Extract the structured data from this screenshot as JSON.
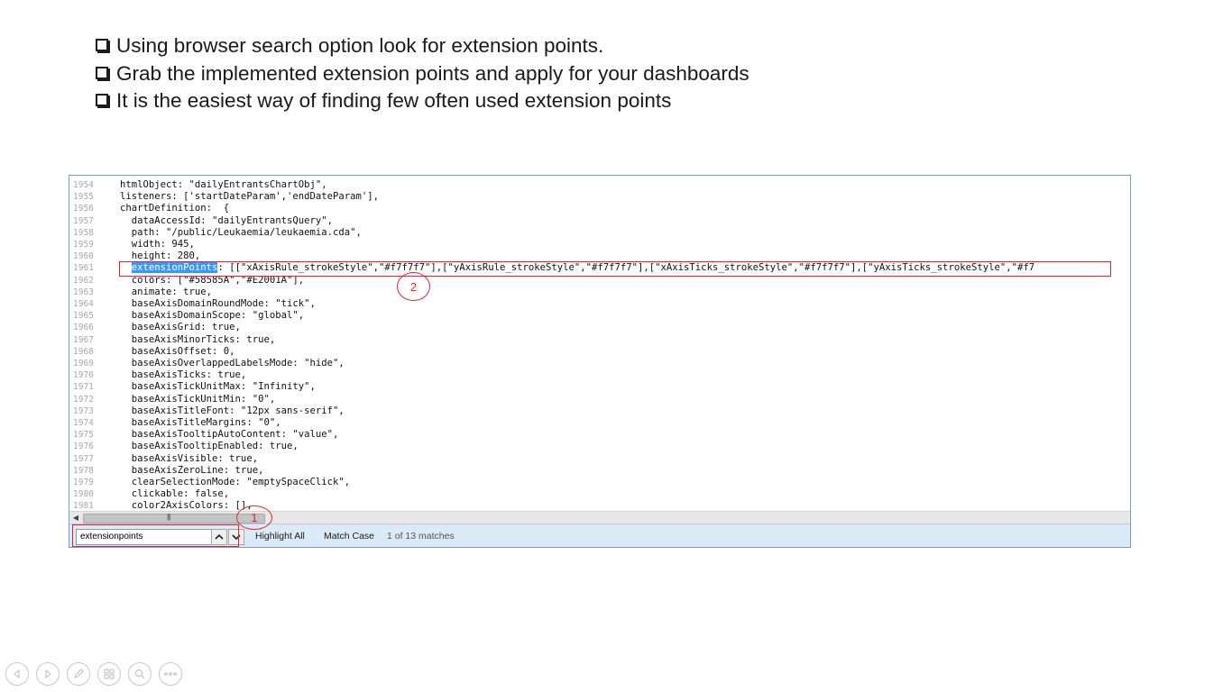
{
  "bullets": [
    "Using browser search option look for extension points.",
    "Grab the implemented extension points and apply for your dashboards",
    "It is the easiest way of finding few often used extension points"
  ],
  "code_lines": [
    {
      "num": "1954",
      "text": "htmlObject: \"dailyEntrantsChartObj\","
    },
    {
      "num": "1955",
      "text": "listeners: ['startDateParam','endDateParam'],"
    },
    {
      "num": "1956",
      "text": "chartDefinition:  {"
    },
    {
      "num": "1957",
      "text": "  dataAccessId: \"dailyEntrantsQuery\","
    },
    {
      "num": "1958",
      "text": "  path: \"/public/Leukaemia/leukaemia.cda\","
    },
    {
      "num": "1959",
      "text": "  width: 945,"
    },
    {
      "num": "1960",
      "text": "  height: 280,"
    },
    {
      "num": "1961",
      "match": "extensionPoints",
      "rest": ": [[\"xAxisRule_strokeStyle\",\"#f7f7f7\"],[\"yAxisRule_strokeStyle\",\"#f7f7f7\"],[\"xAxisTicks_strokeStyle\",\"#f7f7f7\"],[\"yAxisTicks_strokeStyle\",\"#f7"
    },
    {
      "num": "1962",
      "text": "  colors: [\"#58585A\",\"#E2001A\"],"
    },
    {
      "num": "1963",
      "text": "  animate: true,"
    },
    {
      "num": "1964",
      "text": "  baseAxisDomainRoundMode: \"tick\","
    },
    {
      "num": "1965",
      "text": "  baseAxisDomainScope: \"global\","
    },
    {
      "num": "1966",
      "text": "  baseAxisGrid: true,"
    },
    {
      "num": "1967",
      "text": "  baseAxisMinorTicks: true,"
    },
    {
      "num": "1968",
      "text": "  baseAxisOffset: 0,"
    },
    {
      "num": "1969",
      "text": "  baseAxisOverlappedLabelsMode: \"hide\","
    },
    {
      "num": "1970",
      "text": "  baseAxisTicks: true,"
    },
    {
      "num": "1971",
      "text": "  baseAxisTickUnitMax: \"Infinity\","
    },
    {
      "num": "1972",
      "text": "  baseAxisTickUnitMin: \"0\","
    },
    {
      "num": "1973",
      "text": "  baseAxisTitleFont: \"12px sans-serif\","
    },
    {
      "num": "1974",
      "text": "  baseAxisTitleMargins: \"0\","
    },
    {
      "num": "1975",
      "text": "  baseAxisTooltipAutoContent: \"value\","
    },
    {
      "num": "1976",
      "text": "  baseAxisTooltipEnabled: true,"
    },
    {
      "num": "1977",
      "text": "  baseAxisVisible: true,"
    },
    {
      "num": "1978",
      "text": "  baseAxisZeroLine: true,"
    },
    {
      "num": "1979",
      "text": "  clearSelectionMode: \"emptySpaceClick\","
    },
    {
      "num": "1980",
      "text": "  clickable: false,"
    },
    {
      "num": "1981",
      "text": "  color2AxisColors: [],"
    }
  ],
  "find_bar": {
    "search_value": "extensionpoints",
    "highlight_all_label": "Highlight All",
    "match_case_label": "Match Case",
    "status": "1 of 13 matches"
  },
  "annotations": {
    "circle_1": "1",
    "circle_2": "2"
  },
  "colors": {
    "annotation": "#e0242c",
    "match_highlight": "#3399ff",
    "findbar_bg": "#dce9f7"
  },
  "icons": [
    "previous-slide-icon",
    "next-slide-icon",
    "pen-icon",
    "slides-grid-icon",
    "zoom-icon",
    "more-options-icon"
  ]
}
